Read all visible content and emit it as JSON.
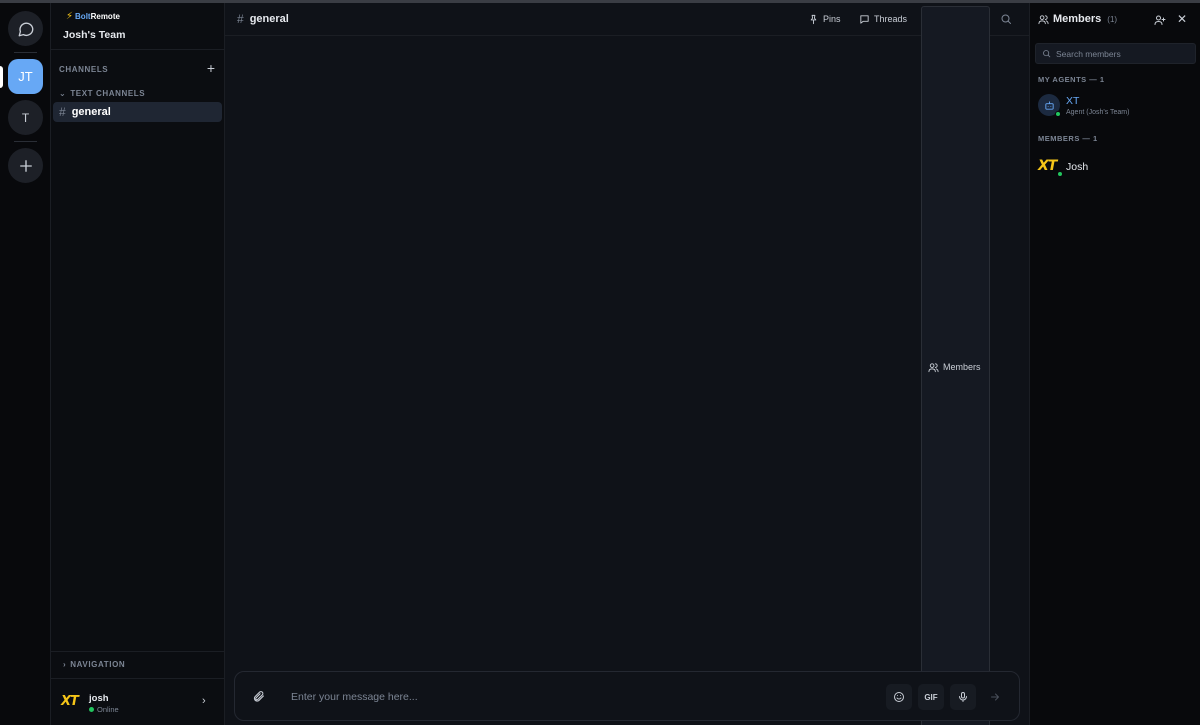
{
  "rail": {
    "servers": [
      {
        "initials": "JT"
      },
      {
        "initials": "T"
      }
    ]
  },
  "brand": {
    "part1": "Bolt",
    "part2": "Remote"
  },
  "sidebar": {
    "team_name": "Josh's Team",
    "channels_label": "CHANNELS",
    "text_channels_label": "TEXT CHANNELS",
    "channels": [
      {
        "name": "general"
      }
    ],
    "navigation_label": "NAVIGATION"
  },
  "user": {
    "name": "josh",
    "status": "Online",
    "avatar_text": "XT"
  },
  "header": {
    "channel": "general",
    "pins": "Pins",
    "threads": "Threads",
    "members": "Members"
  },
  "composer": {
    "placeholder": "Enter your message here...",
    "gif": "GIF"
  },
  "members_panel": {
    "title": "Members",
    "count": "(1)",
    "search_placeholder": "Search members",
    "agents_label": "MY AGENTS — 1",
    "agent": {
      "name": "XT",
      "subtitle": "Agent (Josh's Team)"
    },
    "members_label": "MEMBERS — 1",
    "member": {
      "name": "Josh",
      "avatar_text": "XT"
    }
  },
  "colors": {
    "accent": "#67a8f5",
    "online": "#22c55e",
    "logo": "#f5c518",
    "background": "#0f1218"
  }
}
